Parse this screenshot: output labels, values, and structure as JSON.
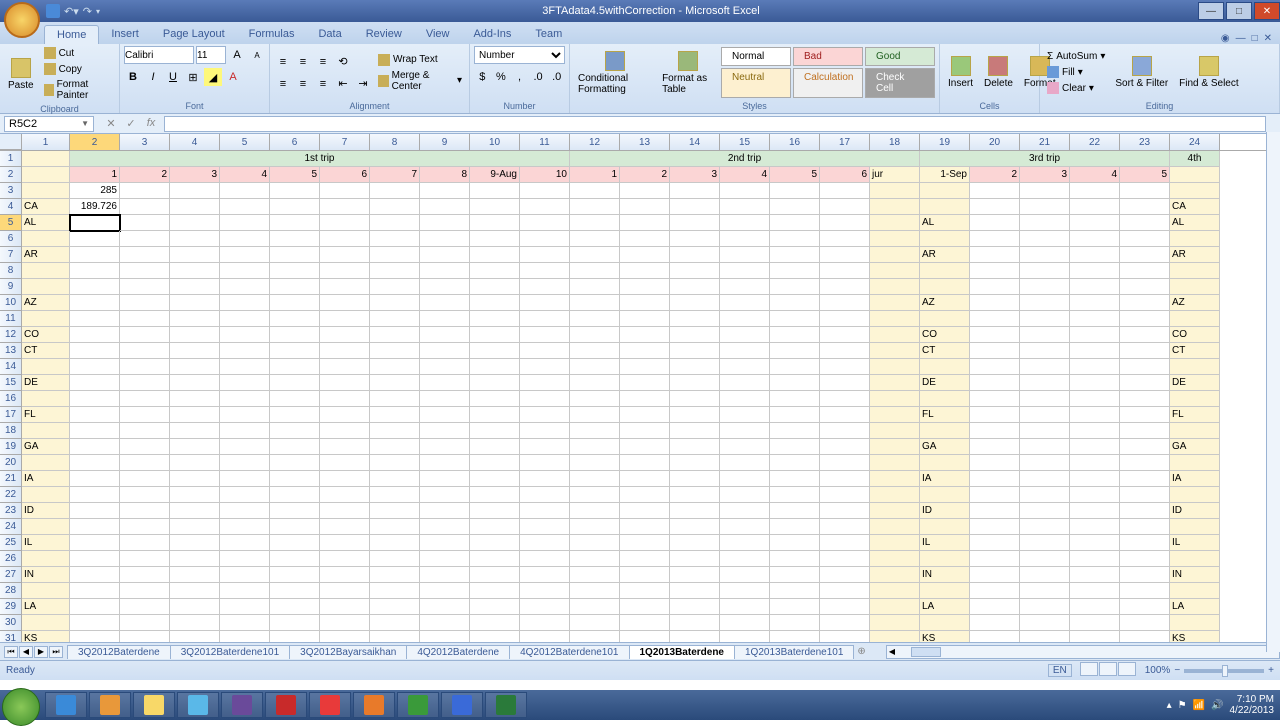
{
  "app": {
    "title": "3FTAdata4.5withCorrection - Microsoft Excel"
  },
  "tabs": {
    "items": [
      "Home",
      "Insert",
      "Page Layout",
      "Formulas",
      "Data",
      "Review",
      "View",
      "Add-Ins",
      "Team"
    ],
    "active": 0
  },
  "ribbon": {
    "clipboard": {
      "label": "Clipboard",
      "paste": "Paste",
      "cut": "Cut",
      "copy": "Copy",
      "fp": "Format Painter"
    },
    "font": {
      "label": "Font",
      "name": "Calibri",
      "size": "11"
    },
    "alignment": {
      "label": "Alignment",
      "wrap": "Wrap Text",
      "merge": "Merge & Center"
    },
    "number": {
      "label": "Number",
      "format": "Number"
    },
    "styles": {
      "label": "Styles",
      "cf": "Conditional Formatting",
      "fat": "Format as Table",
      "normal": "Normal",
      "bad": "Bad",
      "good": "Good",
      "neutral": "Neutral",
      "calc": "Calculation",
      "check": "Check Cell"
    },
    "cells": {
      "label": "Cells",
      "insert": "Insert",
      "delete": "Delete",
      "format": "Format"
    },
    "editing": {
      "label": "Editing",
      "autosum": "AutoSum",
      "fill": "Fill",
      "clear": "Clear",
      "sort": "Sort & Filter",
      "find": "Find & Select"
    }
  },
  "fbar": {
    "namebox": "R5C2",
    "formula": ""
  },
  "columns": [
    {
      "n": "1",
      "w": 48
    },
    {
      "n": "2",
      "w": 50
    },
    {
      "n": "3",
      "w": 50
    },
    {
      "n": "4",
      "w": 50
    },
    {
      "n": "5",
      "w": 50
    },
    {
      "n": "6",
      "w": 50
    },
    {
      "n": "7",
      "w": 50
    },
    {
      "n": "8",
      "w": 50
    },
    {
      "n": "9",
      "w": 50
    },
    {
      "n": "10",
      "w": 50
    },
    {
      "n": "11",
      "w": 50
    },
    {
      "n": "12",
      "w": 50
    },
    {
      "n": "13",
      "w": 50
    },
    {
      "n": "14",
      "w": 50
    },
    {
      "n": "15",
      "w": 50
    },
    {
      "n": "16",
      "w": 50
    },
    {
      "n": "17",
      "w": 50
    },
    {
      "n": "18",
      "w": 50
    },
    {
      "n": "19",
      "w": 50
    },
    {
      "n": "20",
      "w": 50
    },
    {
      "n": "21",
      "w": 50
    },
    {
      "n": "22",
      "w": 50
    },
    {
      "n": "23",
      "w": 50
    },
    {
      "n": "24",
      "w": 50
    }
  ],
  "trip_headers": {
    "t1": "1st trip",
    "t2": "2nd trip",
    "t3": "3rd trip",
    "t4": "4th"
  },
  "row2": [
    "",
    "1",
    "2",
    "3",
    "4",
    "5",
    "6",
    "7",
    "8",
    "9-Aug",
    "10",
    "1",
    "2",
    "3",
    "4",
    "5",
    "6",
    "jur",
    "1-Sep",
    "2",
    "3",
    "4",
    "5"
  ],
  "row3": {
    "c2": "285"
  },
  "row4": {
    "c1": "CA",
    "c2": "189.726",
    "c24": "CA"
  },
  "row5": {
    "c1": "AL",
    "c19": "AL",
    "c24": "AL"
  },
  "row7": {
    "c1": "AR",
    "c19": "AR",
    "c24": "AR"
  },
  "row10": {
    "c1": "AZ",
    "c19": "AZ",
    "c24": "AZ"
  },
  "row12": {
    "c1": "CO",
    "c19": "CO",
    "c24": "CO"
  },
  "row13": {
    "c1": "CT",
    "c19": "CT",
    "c24": "CT"
  },
  "row15": {
    "c1": "DE",
    "c19": "DE",
    "c24": "DE"
  },
  "row17": {
    "c1": "FL",
    "c19": "FL",
    "c24": "FL"
  },
  "row19": {
    "c1": "GA",
    "c19": "GA",
    "c24": "GA"
  },
  "row21": {
    "c1": "IA",
    "c19": "IA",
    "c24": "IA"
  },
  "row23": {
    "c1": "ID",
    "c19": "ID",
    "c24": "ID"
  },
  "row25": {
    "c1": "IL",
    "c19": "IL",
    "c24": "IL"
  },
  "row27": {
    "c1": "IN",
    "c19": "IN",
    "c24": "IN"
  },
  "row29": {
    "c1": "LA",
    "c19": "LA",
    "c24": "LA"
  },
  "row31": {
    "c1": "KS",
    "c19": "KS",
    "c24": "KS"
  },
  "sheets": {
    "items": [
      "3Q2012Baterdene",
      "3Q2012Baterdene101",
      "3Q2012Bayarsaikhan",
      "4Q2012Baterdene",
      "4Q2012Baterdene101",
      "1Q2013Baterdene",
      "1Q2013Baterdene101"
    ],
    "active": 5
  },
  "status": {
    "ready": "Ready",
    "lang": "EN",
    "zoom": "100%"
  },
  "taskbar": {
    "time": "7:10 PM",
    "date": "4/22/2013"
  },
  "colors": {
    "ie": "#3a8ad8",
    "wmp": "#e8983a",
    "expl": "#f8d868",
    "np": "#5ab8e8",
    "ec": "#6a4a9a",
    "ar": "#c82a2a",
    "op": "#e83a3a",
    "ff": "#e87a2a",
    "cr": "#3a9a3a",
    "w": "#3a6ad8",
    "x": "#2a7a3a"
  }
}
